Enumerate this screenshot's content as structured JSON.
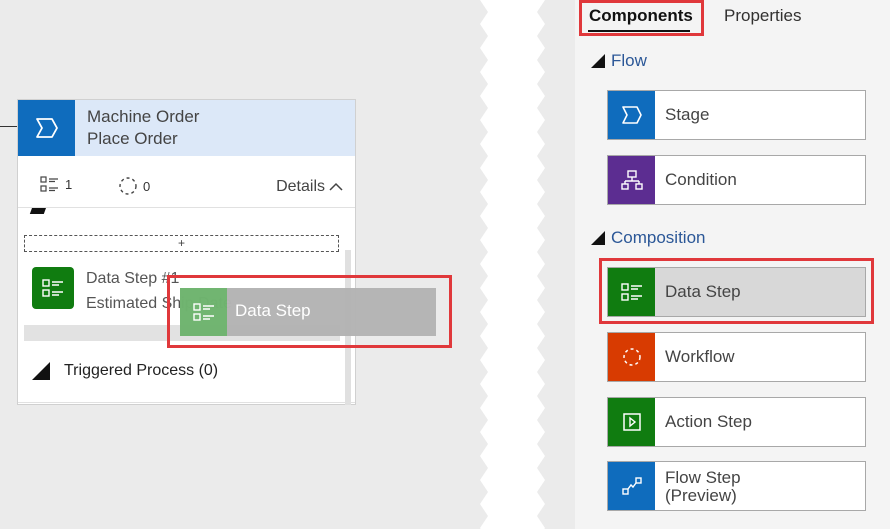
{
  "canvas": {
    "stage": {
      "title": "Machine Order",
      "subtitle": "Place Order",
      "steps_count": "1",
      "workflows_count": "0",
      "details_label": "Details",
      "add_label": "+"
    },
    "data_step": {
      "title": "Data Step #1",
      "subtitle": "Estimated Ship Date"
    },
    "triggered": {
      "label": "Triggered Process (0)"
    },
    "drag_ghost": {
      "label": "Data Step"
    }
  },
  "panel": {
    "tabs": [
      {
        "label": "Components",
        "active": true
      },
      {
        "label": "Properties",
        "active": false
      }
    ],
    "sections": [
      {
        "title": "Flow",
        "items": [
          {
            "label": "Stage",
            "icon": "stage-icon",
            "color": "#0f6cbd"
          },
          {
            "label": "Condition",
            "icon": "condition-icon",
            "color": "#5c2d91"
          }
        ]
      },
      {
        "title": "Composition",
        "items": [
          {
            "label": "Data Step",
            "icon": "data-step-icon",
            "color": "#107c10"
          },
          {
            "label": "Workflow",
            "icon": "workflow-icon",
            "color": "#d83b01"
          },
          {
            "label": "Action Step",
            "icon": "action-step-icon",
            "color": "#107c10"
          },
          {
            "label": "Flow Step",
            "label2": "(Preview)",
            "icon": "flow-step-icon",
            "color": "#0f6cbd"
          }
        ]
      }
    ]
  },
  "colors": {
    "highlight": "#e0383b",
    "stage_header_bg": "#dce8f8",
    "link_blue": "#2b5797"
  }
}
